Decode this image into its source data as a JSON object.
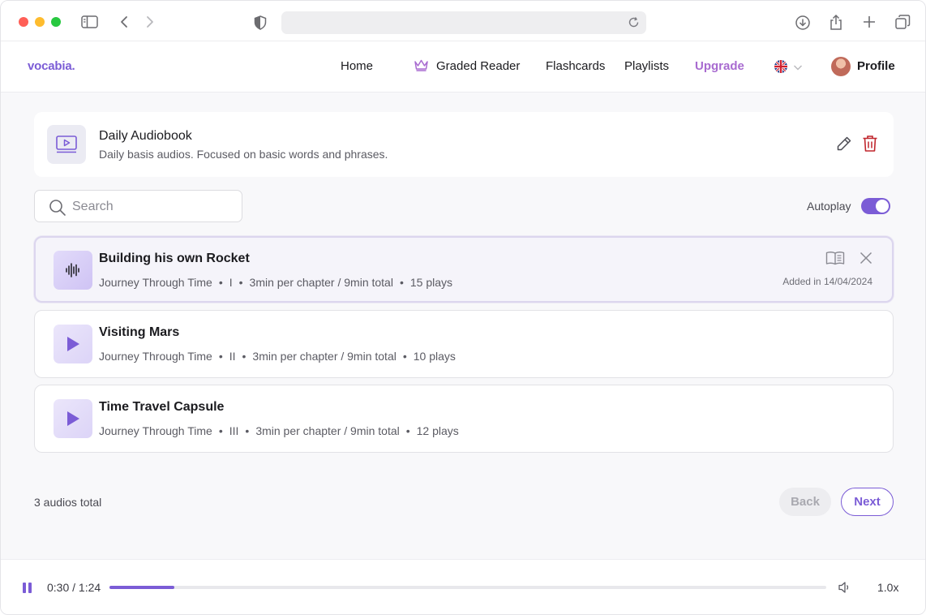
{
  "nav": {
    "logo": "vocabia.",
    "home": "Home",
    "graded_reader": "Graded Reader",
    "flashcards": "Flashcards",
    "playlists": "Playlists",
    "upgrade": "Upgrade",
    "profile": "Profile",
    "language_flag": "uk-flag-icon"
  },
  "playlist": {
    "title": "Daily Audiobook",
    "description": "Daily basis audios. Focused on basic words and phrases."
  },
  "search": {
    "placeholder": "Search"
  },
  "autoplay": {
    "label": "Autoplay",
    "enabled": true
  },
  "tracks": [
    {
      "title": "Building his own Rocket",
      "series": "Journey Through Time",
      "part": "I",
      "duration": "3min per chapter / 9min total",
      "plays": "15 plays",
      "added": "Added in 14/04/2024",
      "active": true
    },
    {
      "title": "Visiting Mars",
      "series": "Journey Through Time",
      "part": "II",
      "duration": "3min per chapter / 9min total",
      "plays": "10 plays",
      "active": false
    },
    {
      "title": "Time Travel Capsule",
      "series": "Journey Through Time",
      "part": "III",
      "duration": "3min per chapter / 9min total",
      "plays": "12 plays",
      "active": false
    }
  ],
  "footer": {
    "total": "3 audios total",
    "back": "Back",
    "next": "Next"
  },
  "player": {
    "time": "0:30 / 1:24",
    "progress_fraction": 0.09,
    "speed": "1.0x"
  },
  "colors": {
    "accent": "#7b5cd6",
    "upgrade": "#a86bd0",
    "delete": "#c0262d"
  }
}
